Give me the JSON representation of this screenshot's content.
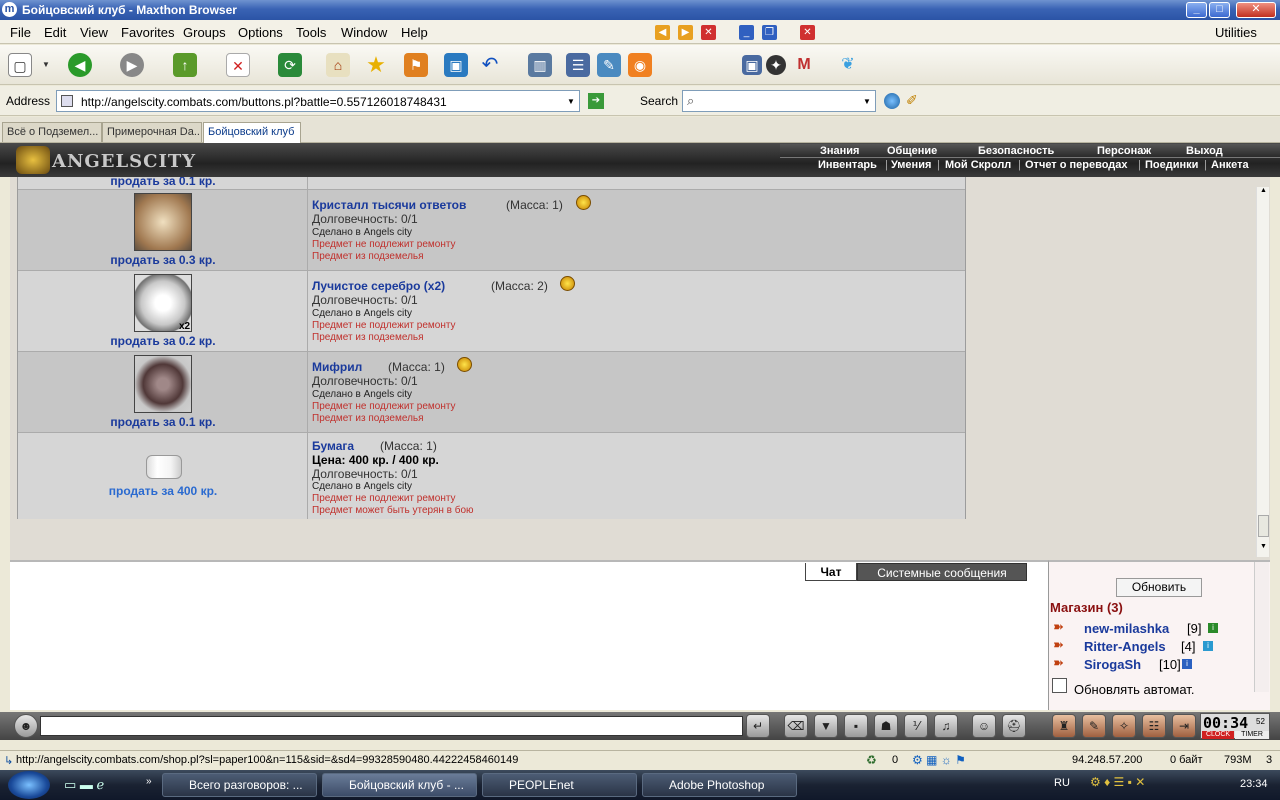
{
  "window": {
    "title": "Бойцовский клуб - Maxthon Browser"
  },
  "menu": [
    "File",
    "Edit",
    "View",
    "Favorites",
    "Groups",
    "Options",
    "Tools",
    "Window",
    "Help"
  ],
  "menu_right": "Utilities",
  "address": {
    "label": "Address",
    "url": "http://angelscity.combats.com/buttons.pl?battle=0.557126018748431",
    "search_label": "Search"
  },
  "tabs": [
    "Всё о Подземел...",
    "Примерочная Da...",
    "Бойцовский клуб"
  ],
  "game": {
    "logo": "ANGELSCITY",
    "nav_top": [
      "Знания",
      "Общение",
      "Безопасность",
      "Персонаж",
      "Выход"
    ],
    "nav_bottom": [
      "Инвентарь",
      "Умения",
      "Мой Скролл",
      "Отчет о переводах",
      "Поединки",
      "Анкета"
    ]
  },
  "items_top_cut": "продать за 0.1 кр.",
  "items": [
    {
      "name": "Кристалл тысячи ответов",
      "mass": "(Масса: 1)",
      "durability": "Долговечность: 0/1",
      "made": "Сделано в Angels city",
      "note1": "Предмет не подлежит ремонту",
      "note2": "Предмет из подземелья",
      "sell": "продать за 0.3 кр."
    },
    {
      "name": "Лучистое серебро (x2)",
      "mass": "(Масса: 2)",
      "durability": "Долговечность: 0/1",
      "made": "Сделано в Angels city",
      "note1": "Предмет не подлежит ремонту",
      "note2": "Предмет из подземелья",
      "sell": "продать за 0.2 кр.",
      "badge": "x2"
    },
    {
      "name": "Мифрил",
      "mass": "(Масса: 1)",
      "durability": "Долговечность: 0/1",
      "made": "Сделано в Angels city",
      "note1": "Предмет не подлежит ремонту",
      "note2": "Предмет из подземелья",
      "sell": "продать за 0.1 кр."
    },
    {
      "name": "Бумага",
      "mass": "(Масса: 1)",
      "price": "Цена: 400 кр. / 400 кр.",
      "durability": "Долговечность: 0/1",
      "made": "Сделано в Angels city",
      "note1": "Предмет не подлежит ремонту",
      "note2": "Предмет может быть утерян в бою",
      "sell": "продать за 400 кр."
    }
  ],
  "chat": {
    "tab_chat": "Чат",
    "tab_system": "Системные сообщения"
  },
  "side": {
    "refresh": "Обновить",
    "room": "Магазин (3)",
    "users": [
      {
        "name": "new-milashka",
        "level": "[9]"
      },
      {
        "name": "Ritter-Angels",
        "level": "[4]"
      },
      {
        "name": "SirogaSh",
        "level": "[10]"
      }
    ],
    "auto": "Обновлять автомат."
  },
  "clock": {
    "time": "00:34",
    "sec": "52",
    "label_a": "CLOCK",
    "label_b": "TIMER"
  },
  "status": {
    "url": "http://angelscity.combats.com/shop.pl?sl=paper100&n=115&sid=&sd4=99328590480.44222458460149",
    "count": "0",
    "ip": "94.248.57.200",
    "bytes": "0 байт",
    "mem": "793M",
    "num": "3"
  },
  "taskbar": {
    "items": [
      "Всего разговоров: ...",
      "Бойцовский клуб - ...",
      "PEOPLEnet",
      "Adobe Photoshop"
    ],
    "lang": "RU",
    "time": "23:34"
  },
  "colors": {
    "link": "#1a3a9c",
    "warn": "#c0302c",
    "header": "#2b2b2b"
  }
}
